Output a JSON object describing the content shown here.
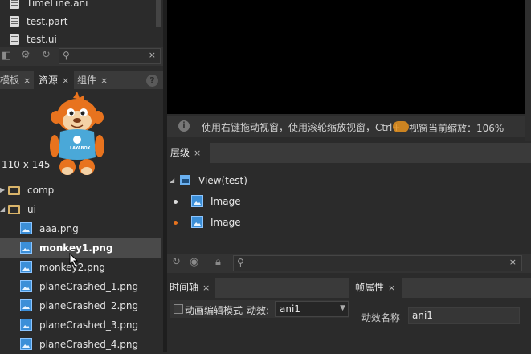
{
  "top_files": [
    {
      "name": "TimeLine.ani",
      "icon": "document-icon"
    },
    {
      "name": "test.part",
      "icon": "document-icon"
    },
    {
      "name": "test.ui",
      "icon": "document-icon"
    }
  ],
  "left_toolbar": {
    "clear": "×"
  },
  "left_tabs": [
    {
      "label": "模板",
      "close": "×"
    },
    {
      "label": "资源",
      "close": "×"
    },
    {
      "label": "组件",
      "close": "×"
    }
  ],
  "help_glyph": "?",
  "preview": {
    "size": "110 x 145",
    "logo_text": "LAYABOX"
  },
  "tree": [
    {
      "name": "comp",
      "type": "folder",
      "expanded": false
    },
    {
      "name": "ui",
      "type": "folder",
      "expanded": true
    }
  ],
  "assets": [
    "aaa.png",
    "monkey1.png",
    "monkey2.png",
    "planeCrashed_1.png",
    "planeCrashed_2.png",
    "planeCrashed_3.png",
    "planeCrashed_4.png"
  ],
  "selected_asset": "monkey1.png",
  "canvas_status": {
    "hint": "使用右键拖动视窗，使用滚轮缩放视窗，Ctrl+",
    "zoom_label": "视窗当前缩放：106%"
  },
  "hierarchy": {
    "tab_label": "层级",
    "close": "×",
    "root": "View(test)",
    "children": [
      "Image",
      "Image"
    ]
  },
  "bottom_toolbar": {
    "clear": "×"
  },
  "timeline": {
    "tab_label": "时间轴",
    "close": "×",
    "mode_label": "动画编辑模式",
    "effect_label": "动效:",
    "effect_value": "ani1"
  },
  "frame_props": {
    "tab_label": "帧属性",
    "close": "×",
    "name_label": "动效名称",
    "name_value": "ani1"
  },
  "colors": {
    "accent": "#3c8fd8",
    "selected_bg": "#4a4a4a",
    "canvas": "#000000",
    "orange": "#e8731e"
  }
}
